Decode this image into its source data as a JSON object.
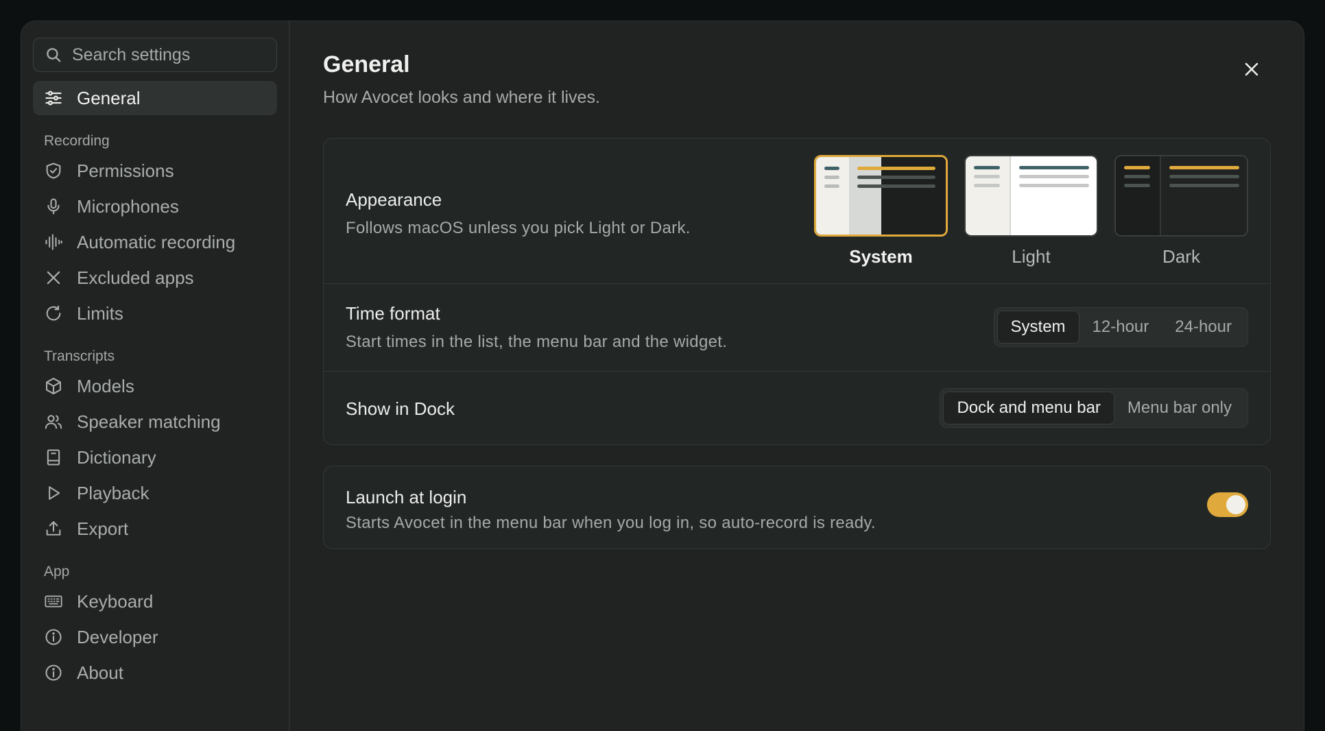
{
  "search": {
    "placeholder": "Search settings"
  },
  "sidebar": {
    "general": "General",
    "sections": [
      {
        "title": "Recording",
        "items": [
          {
            "label": "Permissions",
            "icon": "shield-check-icon"
          },
          {
            "label": "Microphones",
            "icon": "microphone-icon"
          },
          {
            "label": "Automatic recording",
            "icon": "waveform-icon"
          },
          {
            "label": "Excluded apps",
            "icon": "x-icon"
          },
          {
            "label": "Limits",
            "icon": "refresh-icon"
          }
        ]
      },
      {
        "title": "Transcripts",
        "items": [
          {
            "label": "Models",
            "icon": "cube-icon"
          },
          {
            "label": "Speaker matching",
            "icon": "users-icon"
          },
          {
            "label": "Dictionary",
            "icon": "book-icon"
          },
          {
            "label": "Playback",
            "icon": "play-icon"
          },
          {
            "label": "Export",
            "icon": "upload-icon"
          }
        ]
      },
      {
        "title": "App",
        "items": [
          {
            "label": "Keyboard",
            "icon": "keyboard-icon"
          },
          {
            "label": "Developer",
            "icon": "info-icon"
          },
          {
            "label": "About",
            "icon": "info-icon"
          }
        ]
      }
    ]
  },
  "main": {
    "title": "General",
    "subtitle": "How Avocet looks and where it lives.",
    "appearance": {
      "title": "Appearance",
      "desc": "Follows macOS unless you pick Light or Dark.",
      "options": [
        "System",
        "Light",
        "Dark"
      ],
      "selected": "System"
    },
    "time_format": {
      "title": "Time format",
      "desc": "Start times in the list, the menu bar and the widget.",
      "options": [
        "System",
        "12-hour",
        "24-hour"
      ],
      "selected": "System"
    },
    "dock": {
      "title": "Show in Dock",
      "options": [
        "Dock and menu bar",
        "Menu bar only"
      ],
      "selected": "Dock and menu bar"
    },
    "launch": {
      "title": "Launch at login",
      "desc": "Starts Avocet in the menu bar when you log in, so auto-record is ready.",
      "enabled": true
    }
  },
  "colors": {
    "accent": "#e0a93c",
    "background": "#202322",
    "sidebar_active": "#2f3332"
  }
}
